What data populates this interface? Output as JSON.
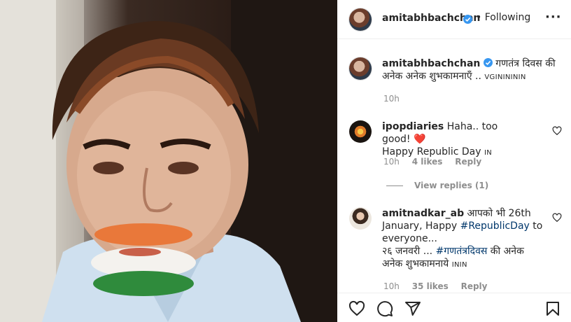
{
  "post": {
    "image_alt": "Portrait of Amitabh Bachchan with tricolour painted on chin"
  },
  "header": {
    "username": "amitabhbachchan",
    "separator": "•",
    "follow_status": "Following",
    "more_icon": "more-horizontal-icon"
  },
  "caption": {
    "username": "amitabhbachchan",
    "text": "गणतंत्र दिवस की अनेक अनेक शुभकामनाएँ ..",
    "suffix": "VGININININ",
    "time": "10h"
  },
  "comments": [
    {
      "username": "ipopdiaries",
      "text": "Haha.. too good!",
      "emoji": "❤️",
      "line2": "Happy Republic Day",
      "flag": "IN",
      "time": "10h",
      "likes": "4 likes",
      "reply": "Reply",
      "view_replies": "View replies (1)"
    },
    {
      "username": "amitnadkar_ab",
      "text": "आपको भी 26th January, Happy",
      "hashtag": "#RepublicDay",
      "text2": "to everyone...",
      "line3": "२६ जनवरी ...",
      "hashtag2": "#गणतंत्रदिवस",
      "text3": "की अनेक अनेक शुभकामनाये",
      "flag": "ININ",
      "time": "10h",
      "likes": "35 likes",
      "reply": "Reply"
    }
  ],
  "actions": {
    "like_icon": "heart-icon",
    "comment_icon": "comment-icon",
    "share_icon": "send-icon",
    "save_icon": "bookmark-icon"
  }
}
